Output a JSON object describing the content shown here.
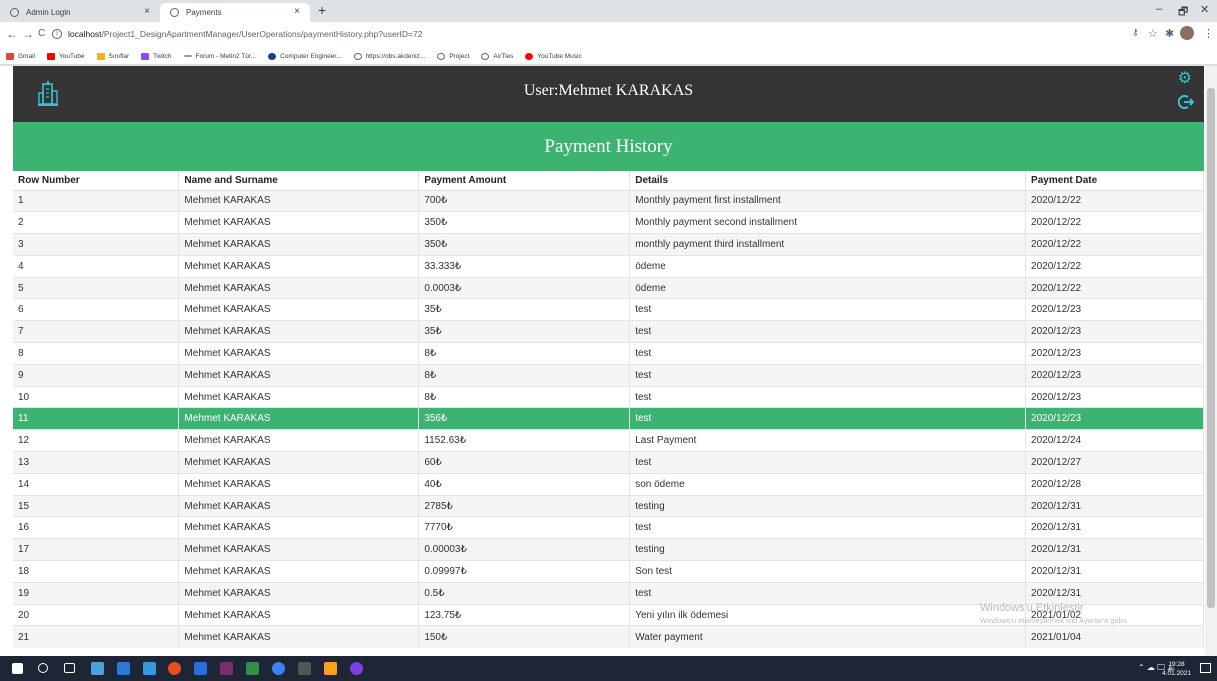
{
  "browser": {
    "tabs": [
      {
        "label": "Admin Login",
        "close": "×"
      },
      {
        "label": "Payments",
        "close": "×"
      }
    ],
    "new_tab": "+",
    "window": {
      "minimize": "–",
      "maximize": "🗗",
      "close": "✕"
    },
    "nav": {
      "back": "←",
      "forward": "→",
      "reload": "C"
    },
    "url_host": "localhost",
    "url_path": "/Project1_DesignApartmentManager/UserOperations/paymentHistory.php?userID=72",
    "bookmarks": [
      "Gmail",
      "YouTube",
      "Sınıflar",
      "Twitch",
      "Forum - Metin2 Tür...",
      "Computer Engineer...",
      "https://obs.akdeniz...",
      "Project",
      "AirTies",
      "YouTube Music"
    ]
  },
  "page": {
    "user_label": "User:Mehmet KARAKAS",
    "title": "Payment History",
    "columns": [
      "Row Number",
      "Name and Surname",
      "Payment Amount",
      "Details",
      "Payment Date"
    ],
    "highlighted_row": 11,
    "accent_color": "#3cb371",
    "header_color": "#343434",
    "rows": [
      {
        "num": "1",
        "name": "Mehmet KARAKAS",
        "amount": "700₺",
        "details": "Monthly payment first installment",
        "date": "2020/12/22"
      },
      {
        "num": "2",
        "name": "Mehmet KARAKAS",
        "amount": "350₺",
        "details": "Monthly payment second installment",
        "date": "2020/12/22"
      },
      {
        "num": "3",
        "name": "Mehmet KARAKAS",
        "amount": "350₺",
        "details": "monthly payment third installment",
        "date": "2020/12/22"
      },
      {
        "num": "4",
        "name": "Mehmet KARAKAS",
        "amount": "33.333₺",
        "details": "ödeme",
        "date": "2020/12/22"
      },
      {
        "num": "5",
        "name": "Mehmet KARAKAS",
        "amount": "0.0003₺",
        "details": "ödeme",
        "date": "2020/12/22"
      },
      {
        "num": "6",
        "name": "Mehmet KARAKAS",
        "amount": "35₺",
        "details": "test",
        "date": "2020/12/23"
      },
      {
        "num": "7",
        "name": "Mehmet KARAKAS",
        "amount": "35₺",
        "details": "test",
        "date": "2020/12/23"
      },
      {
        "num": "8",
        "name": "Mehmet KARAKAS",
        "amount": "8₺",
        "details": "test",
        "date": "2020/12/23"
      },
      {
        "num": "9",
        "name": "Mehmet KARAKAS",
        "amount": "8₺",
        "details": "test",
        "date": "2020/12/23"
      },
      {
        "num": "10",
        "name": "Mehmet KARAKAS",
        "amount": "8₺",
        "details": "test",
        "date": "2020/12/23"
      },
      {
        "num": "11",
        "name": "Mehmet KARAKAS",
        "amount": "356₺",
        "details": "test",
        "date": "2020/12/23"
      },
      {
        "num": "12",
        "name": "Mehmet KARAKAS",
        "amount": "1152.63₺",
        "details": "Last Payment",
        "date": "2020/12/24"
      },
      {
        "num": "13",
        "name": "Mehmet KARAKAS",
        "amount": "60₺",
        "details": "test",
        "date": "2020/12/27"
      },
      {
        "num": "14",
        "name": "Mehmet KARAKAS",
        "amount": "40₺",
        "details": "son ödeme",
        "date": "2020/12/28"
      },
      {
        "num": "15",
        "name": "Mehmet KARAKAS",
        "amount": "2785₺",
        "details": "testing",
        "date": "2020/12/31"
      },
      {
        "num": "16",
        "name": "Mehmet KARAKAS",
        "amount": "7770₺",
        "details": "test",
        "date": "2020/12/31"
      },
      {
        "num": "17",
        "name": "Mehmet KARAKAS",
        "amount": "0.00003₺",
        "details": "testing",
        "date": "2020/12/31"
      },
      {
        "num": "18",
        "name": "Mehmet KARAKAS",
        "amount": "0.09997₺",
        "details": "Son test",
        "date": "2020/12/31"
      },
      {
        "num": "19",
        "name": "Mehmet KARAKAS",
        "amount": "0.5₺",
        "details": "test",
        "date": "2020/12/31"
      },
      {
        "num": "20",
        "name": "Mehmet KARAKAS",
        "amount": "123.75₺",
        "details": "Yeni yılın ilk ödemesi",
        "date": "2021/01/02"
      },
      {
        "num": "21",
        "name": "Mehmet KARAKAS",
        "amount": "150₺",
        "details": "Water payment",
        "date": "2021/01/04"
      }
    ]
  },
  "watermark": {
    "line1": "Windows'u Etkinleştir",
    "line2": "Windows'u etkinleştirmek için Ayarlar'a gidin."
  },
  "taskbar": {
    "time": "19:28",
    "date": "4.01.2021"
  }
}
